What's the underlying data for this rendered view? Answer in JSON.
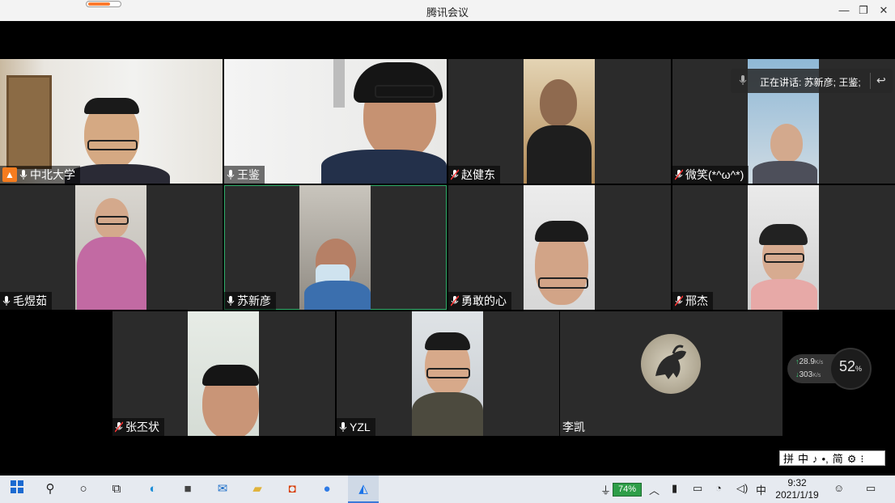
{
  "window": {
    "title": "腾讯会议",
    "minimize": "—",
    "restore": "❐",
    "close": "✕",
    "progress_fraction": 0.72
  },
  "speaking": {
    "text": "正在讲话: 苏新彦; 王鉴;"
  },
  "participants": [
    {
      "name": "中北大学",
      "host": true,
      "mic": "on",
      "active": false
    },
    {
      "name": "王鉴",
      "host": false,
      "mic": "on",
      "active": false
    },
    {
      "name": "赵健东",
      "host": false,
      "mic": "muted",
      "active": false
    },
    {
      "name": "微笑(*^ω^*)",
      "host": false,
      "mic": "muted",
      "active": false
    },
    {
      "name": "毛煜茹",
      "host": false,
      "mic": "on",
      "active": false
    },
    {
      "name": "苏新彦",
      "host": false,
      "mic": "on",
      "active": true
    },
    {
      "name": "勇敢的心",
      "host": false,
      "mic": "muted",
      "active": false
    },
    {
      "name": "邢杰",
      "host": false,
      "mic": "muted",
      "active": false
    },
    {
      "name": "张丕状",
      "host": false,
      "mic": "muted",
      "active": false
    },
    {
      "name": "YZL",
      "host": false,
      "mic": "on",
      "active": false
    },
    {
      "name": "李凯",
      "host": false,
      "mic": "none",
      "active": false
    }
  ],
  "network": {
    "upload": "28.9",
    "upload_unit": "K/s",
    "download": "303",
    "download_unit": "K/s",
    "cpu_percent": "52",
    "cpu_unit": "%"
  },
  "ime": {
    "items": [
      "拼",
      "中",
      "♪",
      "•,",
      "简",
      "⚙",
      "⁝"
    ]
  },
  "taskbar": {
    "battery": "74%",
    "ime_lang": "中",
    "time": "9:32",
    "date": "2021/1/19"
  },
  "colors": {
    "accent_green": "#2fae6a",
    "host_orange": "#f57c1f",
    "tile_bg": "#2b2b2b"
  }
}
